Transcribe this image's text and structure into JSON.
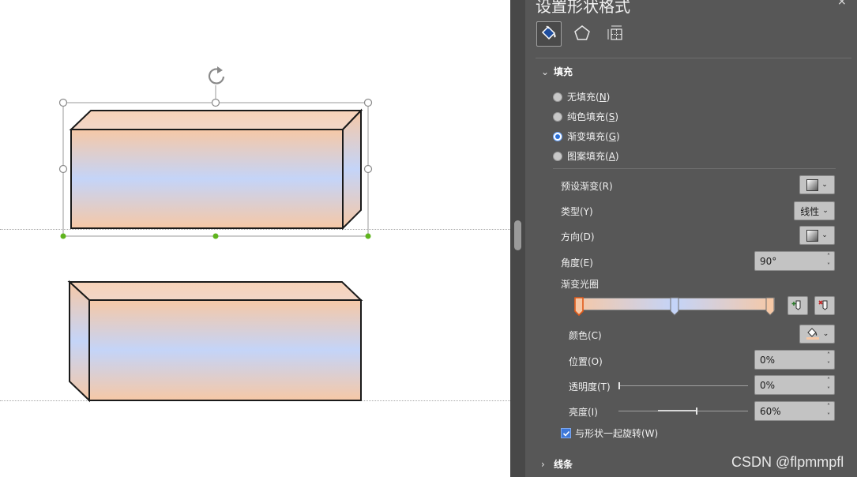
{
  "canvas": {
    "shape_fill_colors": {
      "edge": "#f6c8a6",
      "middle": "#c4d4f8"
    },
    "handle_colors": {
      "resize": "#ffffff",
      "connection": "#5fb41e"
    },
    "rotate_icon": "rotate-icon"
  },
  "pane": {
    "title": "设置形状格式",
    "controls": {
      "collapse": "˅",
      "close": "×"
    },
    "tabs": [
      {
        "icon": "paint-bucket-icon",
        "active": true
      },
      {
        "icon": "pentagon-icon",
        "active": false
      },
      {
        "icon": "size-layout-icon",
        "active": false
      }
    ],
    "fill_section": {
      "header": "填充",
      "options": [
        {
          "label": "无填充(N)",
          "hotkey": "N",
          "checked": false
        },
        {
          "label": "纯色填充(S)",
          "hotkey": "S",
          "checked": false
        },
        {
          "label": "渐变填充(G)",
          "hotkey": "G",
          "checked": true
        },
        {
          "label": "图案填充(A)",
          "hotkey": "A",
          "checked": false
        }
      ],
      "preset_gradient_label": "预设渐变(R)",
      "type_label": "类型(Y)",
      "type_value": "线性",
      "direction_label": "方向(D)",
      "angle_label": "角度(E)",
      "angle_value": "90°",
      "stops_label": "渐变光圈",
      "stop_positions": [
        0,
        50,
        100
      ],
      "stop_colors": [
        "#f6c8a6",
        "#c4d4f8",
        "#f6c8a6"
      ],
      "selected_stop": 0,
      "add_stop_icon": "add-gradient-stop-icon",
      "remove_stop_icon": "remove-gradient-stop-icon",
      "color_label": "颜色(C)",
      "position_label": "位置(O)",
      "position_value": "0%",
      "transparency_label": "透明度(T)",
      "transparency_value": "0%",
      "transparency_level": 0,
      "brightness_label": "亮度(I)",
      "brightness_value": "60%",
      "brightness_level": 0.6,
      "rotate_with_shape_label": "与形状一起旋转(W)",
      "rotate_with_shape_checked": true
    },
    "line_section": {
      "header": "线条"
    }
  },
  "watermark": "CSDN @flpmmpfl"
}
